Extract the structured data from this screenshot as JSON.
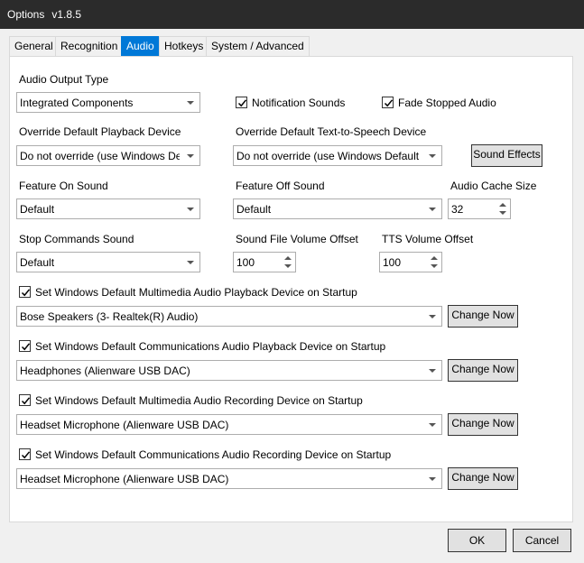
{
  "window": {
    "title": "Options",
    "version": "v1.8.5"
  },
  "tabs": [
    "General",
    "Recognition",
    "Audio",
    "Hotkeys",
    "System / Advanced"
  ],
  "audio_output_type": {
    "label": "Audio Output Type",
    "value": "Integrated Components"
  },
  "notification_sounds": {
    "label": "Notification Sounds",
    "checked": true
  },
  "fade_stopped_audio": {
    "label": "Fade Stopped Audio",
    "checked": true
  },
  "override_playback": {
    "label": "Override Default Playback Device",
    "value": "Do not override (use Windows Defa"
  },
  "override_tts": {
    "label": "Override Default Text-to-Speech Device",
    "value": "Do not override (use Windows Default Pl"
  },
  "sound_effects_button": "Sound Effects",
  "feature_on_sound": {
    "label": "Feature On Sound",
    "value": "Default"
  },
  "feature_off_sound": {
    "label": "Feature Off Sound",
    "value": "Default"
  },
  "audio_cache_size": {
    "label": "Audio Cache Size",
    "value": "32"
  },
  "stop_commands_sound": {
    "label": "Stop Commands Sound",
    "value": "Default"
  },
  "sound_file_volume_offset": {
    "label": "Sound File Volume Offset",
    "value": "100"
  },
  "tts_volume_offset": {
    "label": "TTS Volume Offset",
    "value": "100"
  },
  "startup_devices": [
    {
      "label": "Set Windows Default Multimedia Audio Playback Device on Startup",
      "checked": true,
      "device": "Bose Speakers (3- Realtek(R) Audio)",
      "button": "Change Now"
    },
    {
      "label": "Set Windows Default Communications Audio Playback Device on Startup",
      "checked": true,
      "device": "Headphones (Alienware USB DAC)",
      "button": "Change Now"
    },
    {
      "label": "Set Windows Default Multimedia Audio Recording Device on Startup",
      "checked": true,
      "device": "Headset Microphone (Alienware USB DAC)",
      "button": "Change Now"
    },
    {
      "label": "Set Windows Default Communications Audio Recording Device on Startup",
      "checked": true,
      "device": "Headset Microphone (Alienware USB DAC)",
      "button": "Change Now"
    }
  ],
  "footer": {
    "ok": "OK",
    "cancel": "Cancel"
  },
  "colors": {
    "accent": "#0078d7",
    "titlebar": "#2b2b2b"
  }
}
